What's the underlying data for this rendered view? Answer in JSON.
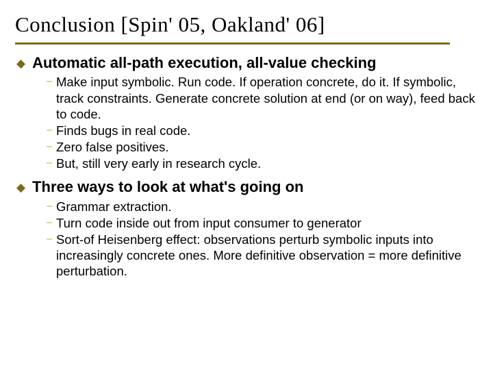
{
  "title": "Conclusion [Spin' 05, Oakland' 06]",
  "points": [
    {
      "heading": "Automatic all-path execution, all-value checking",
      "subs": [
        "Make input symbolic.  Run code.  If operation concrete, do it.  If symbolic, track constraints.  Generate concrete solution at end (or on way), feed back to code.",
        "Finds bugs in real code.",
        "Zero false positives.",
        "But, still very early in research cycle."
      ]
    },
    {
      "heading": "Three ways to look at what's going on",
      "subs": [
        "Grammar extraction.",
        "Turn code inside out from input consumer to generator",
        "Sort-of Heisenberg effect: observations perturb symbolic inputs into increasingly concrete ones.  More definitive observation = more definitive perturbation."
      ]
    }
  ]
}
